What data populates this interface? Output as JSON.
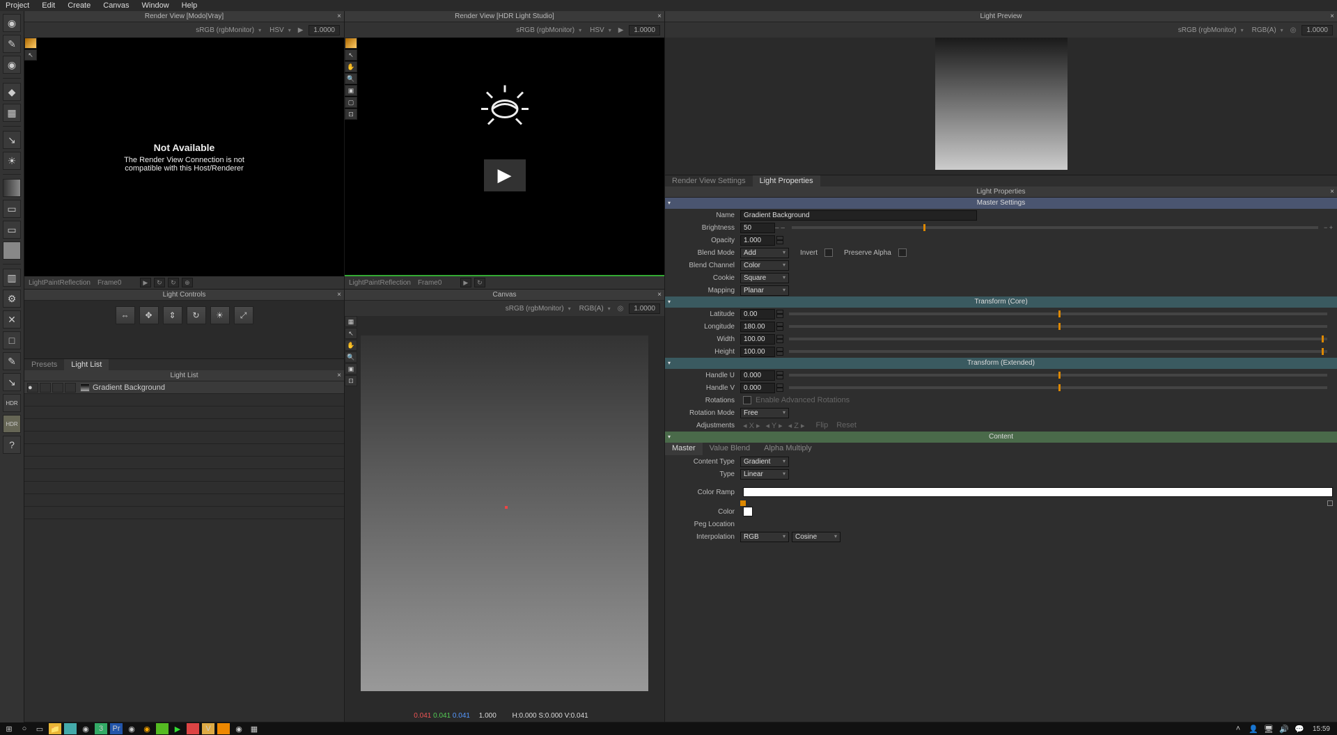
{
  "menu": {
    "items": [
      "Project",
      "Edit",
      "Create",
      "Canvas",
      "Window",
      "Help"
    ]
  },
  "panels": {
    "render1": {
      "title": "Render View [Modo|Vray]",
      "colorSpace": "sRGB (rgbMonitor)",
      "mode": "HSV",
      "exposure": "1.0000",
      "notAvailTitle": "Not Available",
      "notAvailMsg1": "The Render View Connection is not",
      "notAvailMsg2": "compatible with this Host/Renderer",
      "lightPaint": "LightPaint",
      "reflection": "Reflection",
      "frame": "Frame",
      "frameVal": "0"
    },
    "render2": {
      "title": "Render View [HDR Light Studio]",
      "colorSpace": "sRGB (rgbMonitor)",
      "mode": "HSV",
      "exposure": "1.0000",
      "lightPaint": "LightPaint",
      "reflection": "Reflection",
      "frame": "Frame",
      "frameVal": "0"
    },
    "lightControls": {
      "title": "Light Controls"
    },
    "lightList": {
      "title": "Light List",
      "tabPresets": "Presets",
      "tabLightList": "Light List",
      "rows": [
        {
          "name": "Gradient Background"
        }
      ]
    },
    "canvas": {
      "title": "Canvas",
      "colorSpace": "sRGB (rgbMonitor)",
      "channels": "RGB(A)",
      "exposure": "1.0000",
      "statusR": "0.041",
      "statusG": "0.041",
      "statusB": "0.041",
      "statusA": "1.000",
      "statusHSV": "H:0.000 S:0.000 V:0.041"
    },
    "lightPreview": {
      "title": "Light Preview",
      "colorSpace": "sRGB (rgbMonitor)",
      "channels": "RGB(A)",
      "exposure": "1.0000"
    },
    "propTabs": {
      "tab1": "Render View Settings",
      "tab2": "Light Properties"
    },
    "props": {
      "title": "Light Properties",
      "secMaster": "Master Settings",
      "name": {
        "label": "Name",
        "value": "Gradient Background"
      },
      "brightness": {
        "label": "Brightness",
        "value": "50"
      },
      "opacity": {
        "label": "Opacity",
        "value": "1.000"
      },
      "blendMode": {
        "label": "Blend Mode",
        "value": "Add"
      },
      "invert": {
        "label": "Invert"
      },
      "preserveAlpha": {
        "label": "Preserve Alpha"
      },
      "blendChannel": {
        "label": "Blend Channel",
        "value": "Color"
      },
      "cookie": {
        "label": "Cookie",
        "value": "Square"
      },
      "mapping": {
        "label": "Mapping",
        "value": "Planar"
      },
      "secCore": "Transform (Core)",
      "latitude": {
        "label": "Latitude",
        "value": "0.00"
      },
      "longitude": {
        "label": "Longitude",
        "value": "180.00"
      },
      "width": {
        "label": "Width",
        "value": "100.00"
      },
      "height": {
        "label": "Height",
        "value": "100.00"
      },
      "secExt": "Transform (Extended)",
      "handleU": {
        "label": "Handle U",
        "value": "0.000"
      },
      "handleV": {
        "label": "Handle V",
        "value": "0.000"
      },
      "rotations": {
        "label": "Rotations",
        "enable": "Enable Advanced Rotations"
      },
      "rotationMode": {
        "label": "Rotation Mode",
        "value": "Free"
      },
      "adjustments": {
        "label": "Adjustments",
        "x": "X",
        "y": "Y",
        "z": "Z",
        "flip": "Flip",
        "reset": "Reset"
      },
      "secContent": "Content",
      "contentTabs": {
        "master": "Master",
        "valueBlend": "Value Blend",
        "alphaMultiply": "Alpha Multiply"
      },
      "contentType": {
        "label": "Content Type",
        "value": "Gradient"
      },
      "type": {
        "label": "Type",
        "value": "Linear"
      },
      "colorRamp": {
        "label": "Color Ramp"
      },
      "color": {
        "label": "Color"
      },
      "pegLocation": {
        "label": "Peg Location"
      },
      "interpolation": {
        "label": "Interpolation",
        "value1": "RGB",
        "value2": "Cosine"
      }
    }
  },
  "taskbar": {
    "time": "15:59"
  }
}
